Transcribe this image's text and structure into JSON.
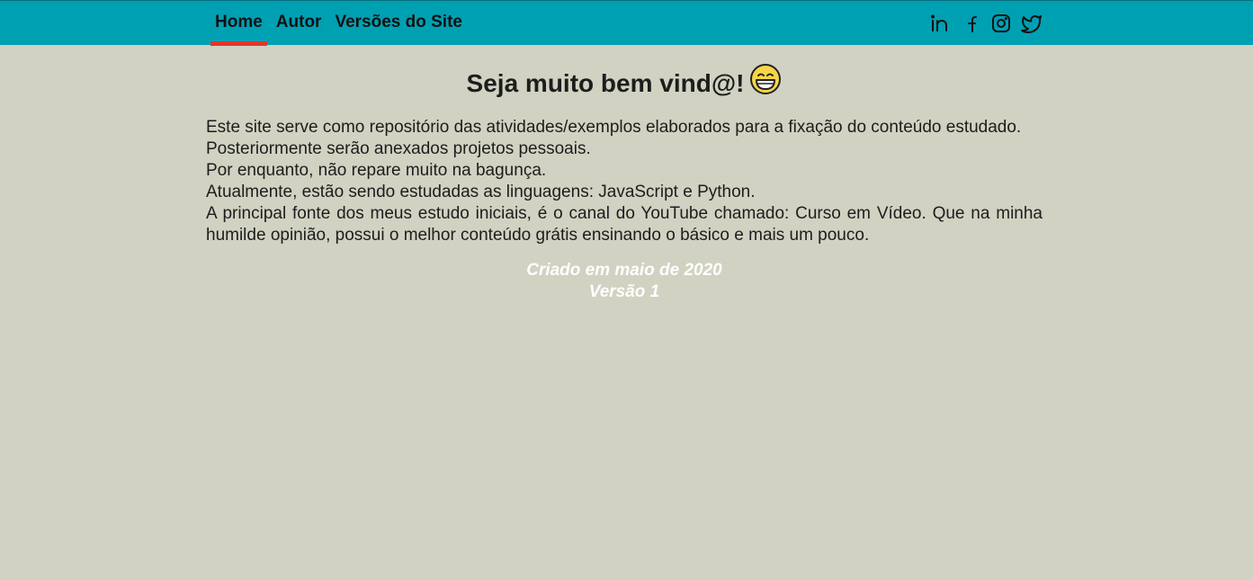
{
  "nav": {
    "items": [
      {
        "label": "Home",
        "active": true
      },
      {
        "label": "Autor",
        "active": false
      },
      {
        "label": "Versões do Site",
        "active": false
      }
    ],
    "social_icons": [
      "linkedin-icon",
      "facebook-icon",
      "instagram-icon",
      "twitter-icon"
    ]
  },
  "main": {
    "title": "Seja muito bem vind@!",
    "title_emoji": "grinning-face-emoji",
    "paragraphs": [
      "Este site serve como repositório das atividades/exemplos elaborados para a fixação do conteúdo estudado.",
      "Posteriormente serão anexados projetos pessoais.",
      "Por enquanto, não repare muito na bagunça.",
      "Atualmente, estão sendo estudadas as linguagens: JavaScript e Python.",
      "A principal fonte dos meus estudo iniciais, é o canal do YouTube chamado: Curso em Vídeo. Que na minha humilde opinião, possui o melhor conteúdo grátis ensinando o básico e mais um pouco."
    ]
  },
  "footer": {
    "created": "Criado em maio de 2020",
    "version": "Versão 1"
  },
  "colors": {
    "topbar": "#00a0b3",
    "active_underline": "#e0382c",
    "background": "#d1d2c2",
    "footer_text": "#ffffff"
  }
}
